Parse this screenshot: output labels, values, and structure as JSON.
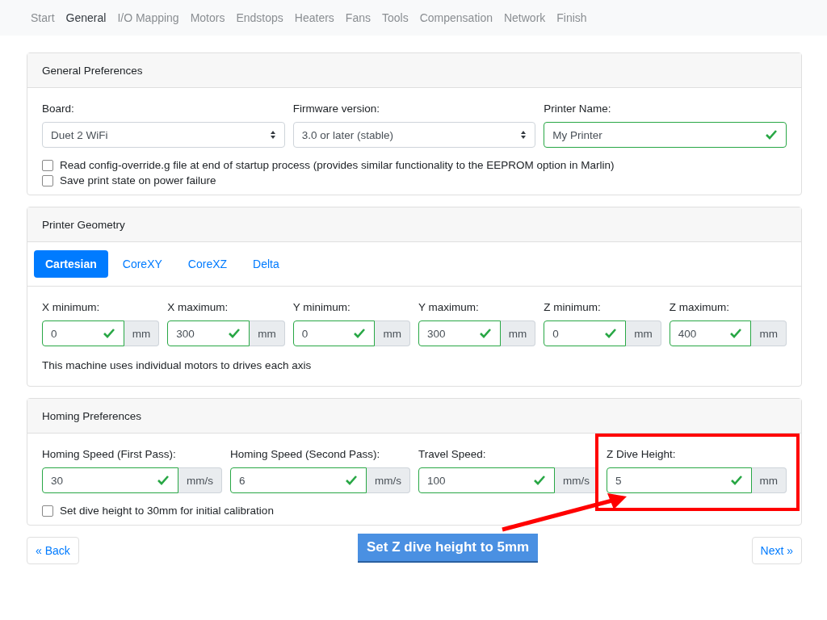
{
  "nav": [
    {
      "label": "Start",
      "selected": false
    },
    {
      "label": "General",
      "selected": true
    },
    {
      "label": "I/O Mapping",
      "selected": false
    },
    {
      "label": "Motors",
      "selected": false
    },
    {
      "label": "Endstops",
      "selected": false
    },
    {
      "label": "Heaters",
      "selected": false
    },
    {
      "label": "Fans",
      "selected": false
    },
    {
      "label": "Tools",
      "selected": false
    },
    {
      "label": "Compensation",
      "selected": false
    },
    {
      "label": "Network",
      "selected": false
    },
    {
      "label": "Finish",
      "selected": false
    }
  ],
  "general": {
    "title": "General Preferences",
    "fields": [
      {
        "kind": "select",
        "label": "Board:",
        "value": "Duet 2 WiFi",
        "valid": false
      },
      {
        "kind": "select",
        "label": "Firmware version:",
        "value": "3.0 or later (stable)",
        "valid": false
      },
      {
        "kind": "text",
        "label": "Printer Name:",
        "value": "My Printer",
        "valid": true
      }
    ],
    "checkboxes": [
      {
        "label": "Read config-override.g file at end of startup process (provides similar functionality to the EEPROM option in Marlin)",
        "checked": false
      },
      {
        "label": "Save print state on power failure",
        "checked": false
      }
    ]
  },
  "geometry": {
    "title": "Printer Geometry",
    "tabs": [
      {
        "label": "Cartesian",
        "selected": true
      },
      {
        "label": "CoreXY",
        "selected": false
      },
      {
        "label": "CoreXZ",
        "selected": false
      },
      {
        "label": "Delta",
        "selected": false
      }
    ],
    "fields": [
      {
        "label": "X minimum:",
        "value": "0",
        "unit": "mm",
        "valid": true
      },
      {
        "label": "X maximum:",
        "value": "300",
        "unit": "mm",
        "valid": true
      },
      {
        "label": "Y minimum:",
        "value": "0",
        "unit": "mm",
        "valid": true
      },
      {
        "label": "Y maximum:",
        "value": "300",
        "unit": "mm",
        "valid": true
      },
      {
        "label": "Z minimum:",
        "value": "0",
        "unit": "mm",
        "valid": true
      },
      {
        "label": "Z maximum:",
        "value": "400",
        "unit": "mm",
        "valid": true
      }
    ],
    "note": "This machine uses individual motors to drives each axis"
  },
  "homing": {
    "title": "Homing Preferences",
    "fields": [
      {
        "label": "Homing Speed (First Pass):",
        "value": "30",
        "unit": "mm/s",
        "valid": true,
        "highlighted": false
      },
      {
        "label": "Homing Speed (Second Pass):",
        "value": "6",
        "unit": "mm/s",
        "valid": true,
        "highlighted": false
      },
      {
        "label": "Travel Speed:",
        "value": "100",
        "unit": "mm/s",
        "valid": true,
        "highlighted": false
      },
      {
        "label": "Z Dive Height:",
        "value": "5",
        "unit": "mm",
        "valid": true,
        "highlighted": true
      }
    ],
    "checkboxes": [
      {
        "label": "Set dive height to 30mm for initial calibration",
        "checked": false
      }
    ]
  },
  "callout": "Set Z dive height to 5mm",
  "buttons": [
    {
      "label": "« Back"
    },
    {
      "label": "Next »"
    }
  ]
}
